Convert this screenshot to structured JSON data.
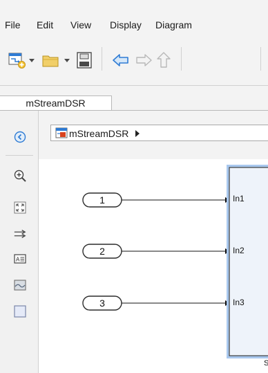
{
  "menu": {
    "items": [
      "File",
      "Edit",
      "View",
      "Display",
      "Diagram"
    ]
  },
  "toolbar": {
    "buttons": [
      "new-model-icon",
      "dropdown-arrow-icon",
      "open-folder-icon",
      "dropdown-arrow-icon",
      "save-icon",
      "back-arrow-icon",
      "forward-arrow-icon",
      "up-arrow-icon"
    ]
  },
  "tabs": [
    {
      "label": "mStreamDSR"
    }
  ],
  "breadcrumb": {
    "model": "mStreamDSR"
  },
  "palette": {
    "buttons": [
      "hide-browser-icon",
      "zoom-icon",
      "fit-to-view-icon",
      "signal-line-icon",
      "annotation-icon",
      "image-icon",
      "area-icon"
    ]
  },
  "diagram": {
    "inports": [
      {
        "number": "1"
      },
      {
        "number": "2"
      },
      {
        "number": "3"
      }
    ],
    "subsystem_inputs": [
      "In1",
      "In2",
      "In3"
    ],
    "subsystem_caption": "S"
  },
  "colors": {
    "accent_blue": "#2e7bd4",
    "folder_yellow": "#e8c04a",
    "block_fill": "#eef3fa",
    "block_border": "#3d3d3d"
  }
}
